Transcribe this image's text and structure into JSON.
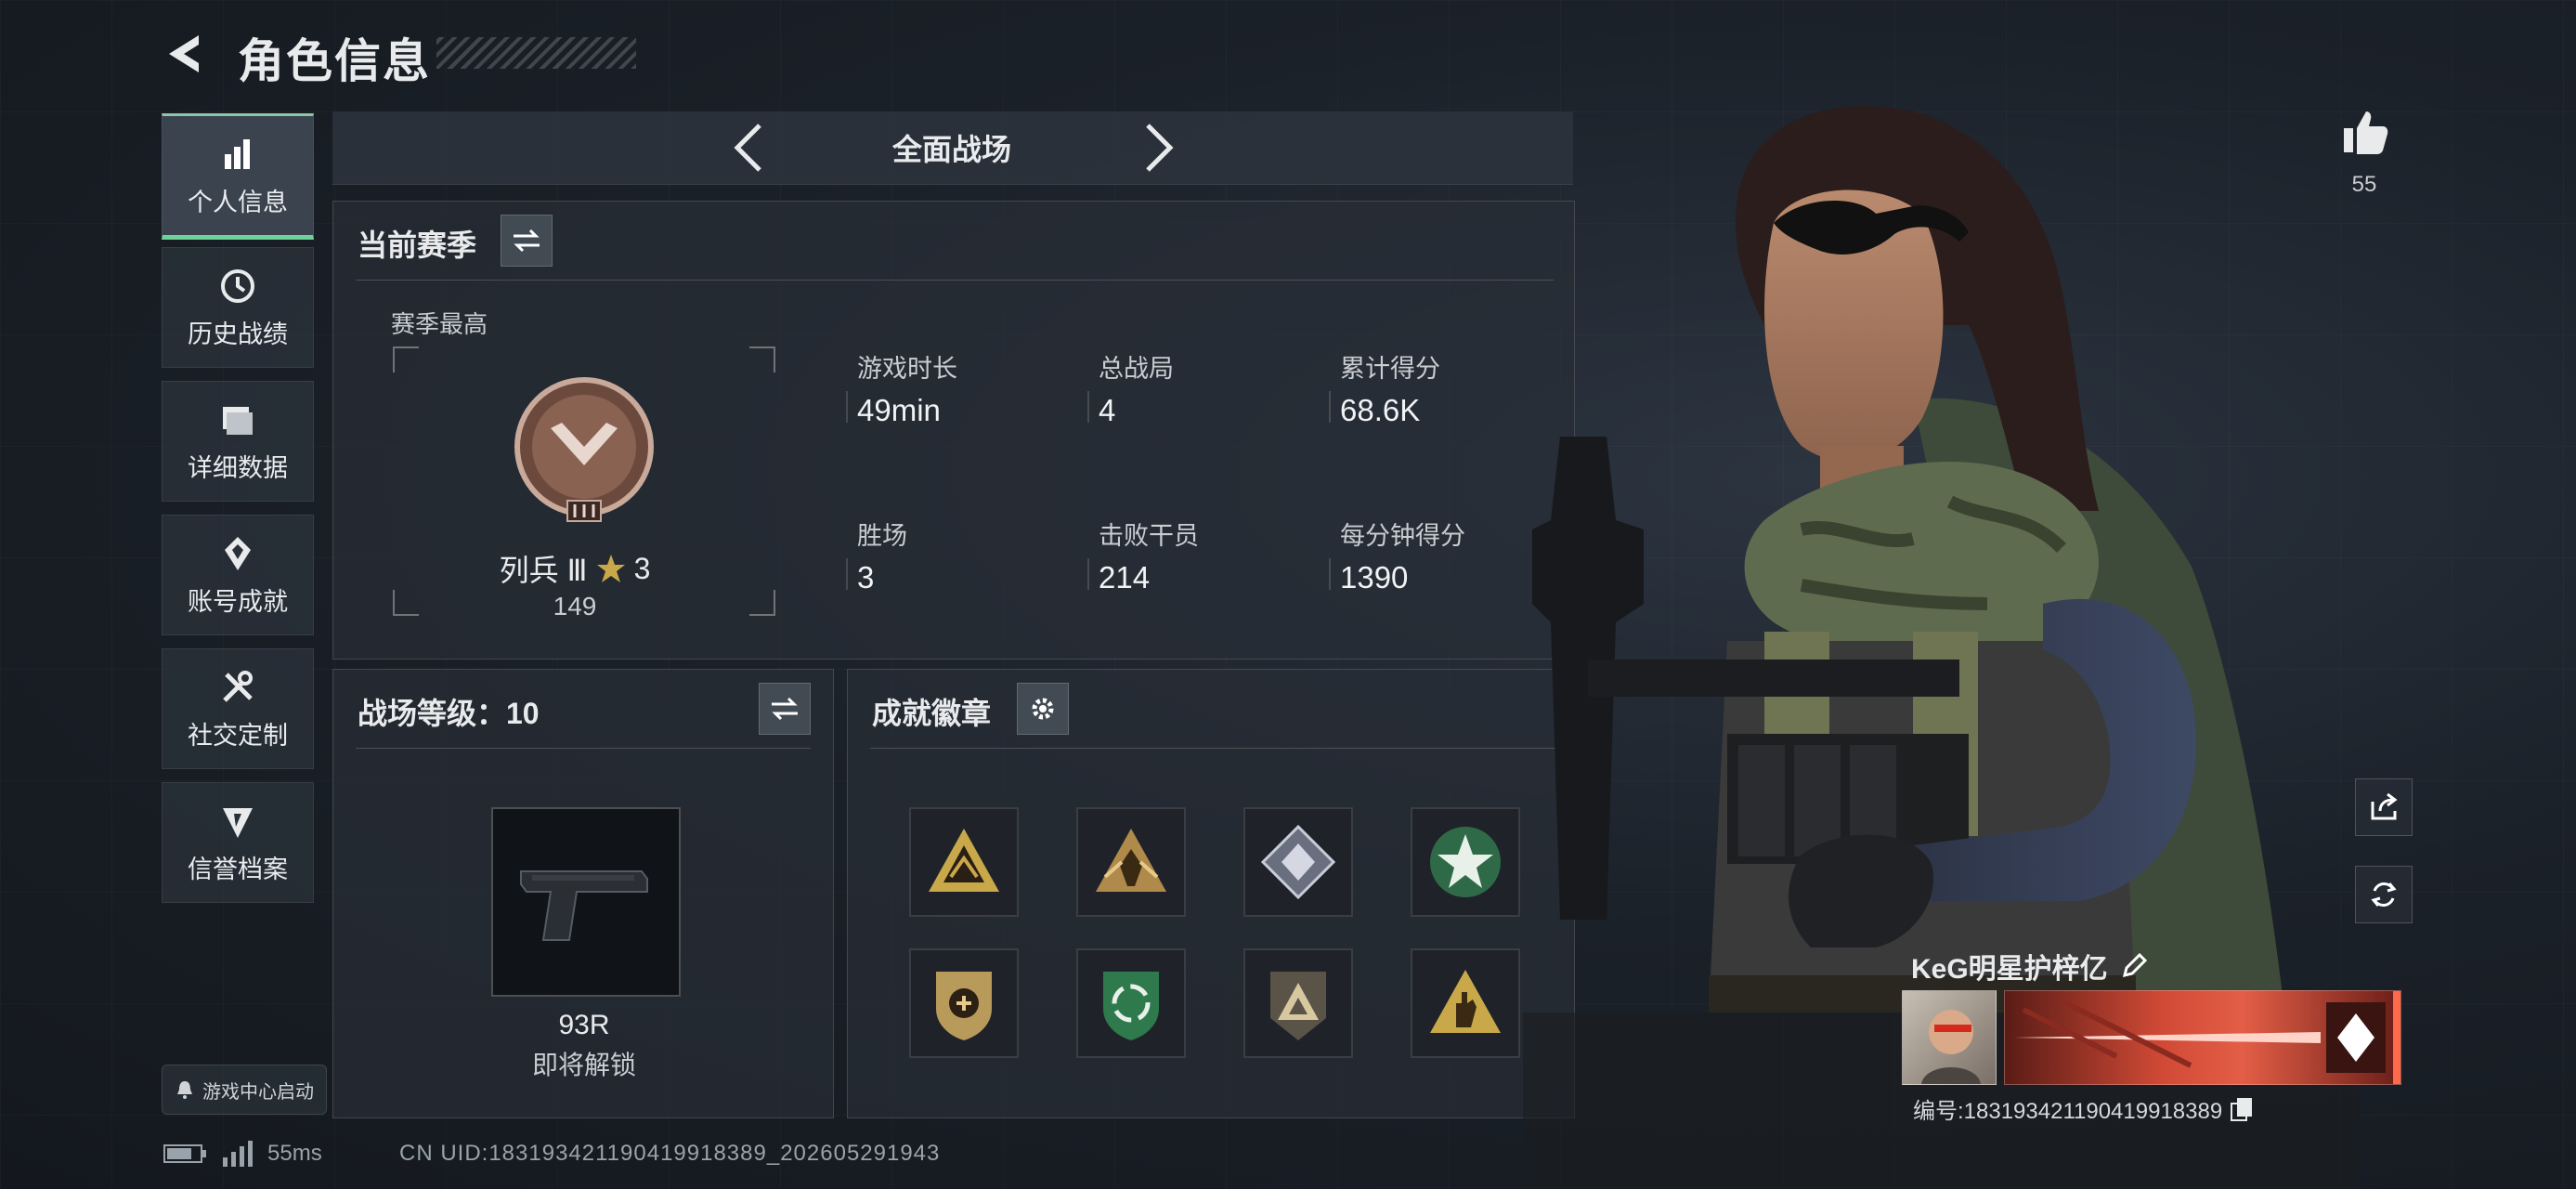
{
  "header": {
    "title": "角色信息"
  },
  "nav": {
    "items": [
      {
        "label": "个人信息",
        "icon": "bar-chart-icon",
        "active": true
      },
      {
        "label": "历史战绩",
        "icon": "history-clock-icon"
      },
      {
        "label": "详细数据",
        "icon": "folder-icon"
      },
      {
        "label": "账号成就",
        "icon": "achievement-diamond-icon"
      },
      {
        "label": "社交定制",
        "icon": "tools-icon"
      },
      {
        "label": "信誉档案",
        "icon": "credit-shield-icon"
      }
    ],
    "launch_label": "游戏中心启动"
  },
  "status": {
    "ping": "55ms",
    "uid": "CN UID:18319342119041991838​9_202605291943"
  },
  "mode": {
    "title": "全面战场"
  },
  "season": {
    "title": "当前赛季",
    "highest_label": "赛季最高",
    "rank_name": "列兵 Ⅲ",
    "rank_stars": "3",
    "rank_points": "149",
    "stats": [
      {
        "label": "游戏时长",
        "value": "49min"
      },
      {
        "label": "总战局",
        "value": "4"
      },
      {
        "label": "累计得分",
        "value": "68.6K"
      },
      {
        "label": "胜场",
        "value": "3"
      },
      {
        "label": "击败干员",
        "value": "214"
      },
      {
        "label": "每分钟得分",
        "value": "1390"
      }
    ]
  },
  "battlefield": {
    "level_label": "战场等级：10",
    "weapon_name": "93R",
    "weapon_status": "即将解锁"
  },
  "achievements": {
    "title": "成就徽章",
    "badges": [
      "mountain-badge-icon",
      "wing-badge-icon",
      "diamond-badge-icon",
      "star-badge-icon",
      "shield-badge-icon",
      "recycle-badge-icon",
      "pyramid-badge-icon",
      "hand-badge-icon"
    ]
  },
  "player": {
    "likes": "55",
    "name": "KeG明星护梓亿",
    "id_text": "编号:18319342119041991838​9",
    "card_logo": "HAVK"
  },
  "colors": {
    "accent": "#6fd19a",
    "card": "#d14a36",
    "gold": "#c9a84a"
  }
}
